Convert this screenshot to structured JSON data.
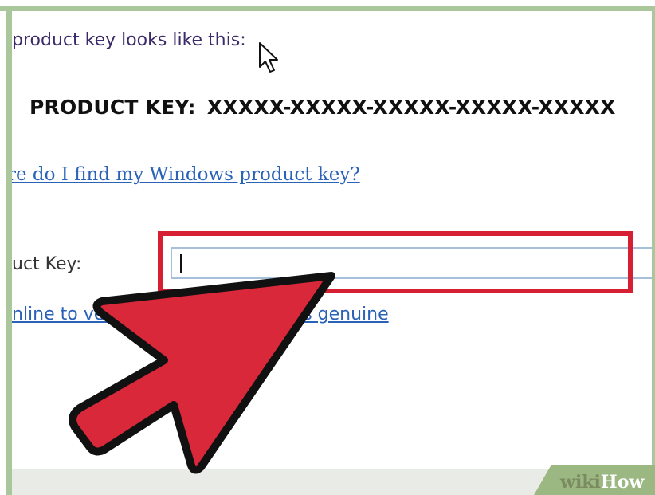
{
  "intro_text": "product key looks like this:",
  "product_key": {
    "label": "PRODUCT KEY:",
    "value": "XXXXX-XXXXX-XXXXX-XXXXX-XXXXX"
  },
  "find_key_link": "re do I find my Windows product key?",
  "key_field": {
    "label": "uct Key:",
    "value": ""
  },
  "online_link": "nline to verify that this software is genuine",
  "watermark": {
    "part1": "wiki",
    "part2": "How"
  },
  "colors": {
    "highlight": "#d61f33",
    "link": "#2a62b8",
    "frame": "#a9c79a"
  }
}
